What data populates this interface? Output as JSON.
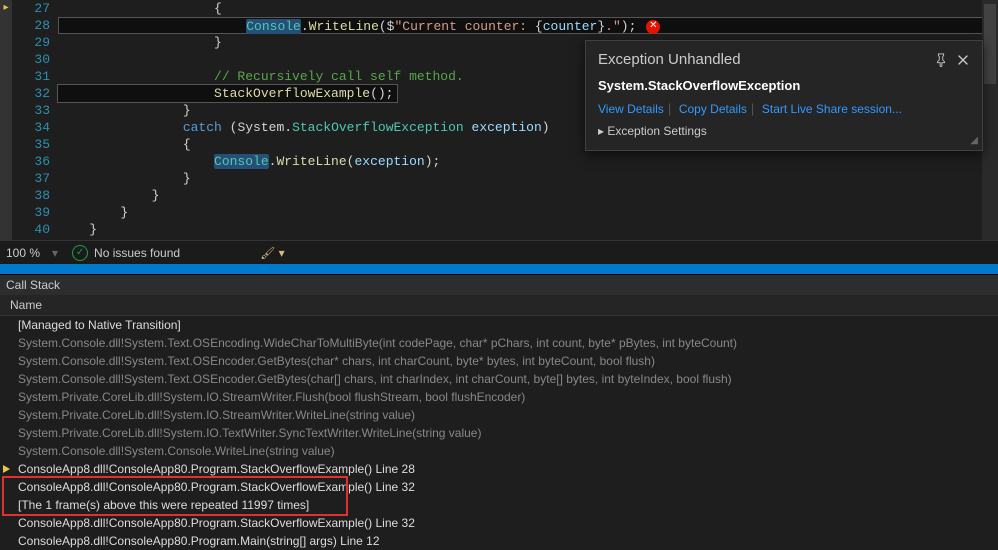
{
  "editor": {
    "line_start": 27,
    "lines": [
      {
        "n": 27,
        "indent": 10,
        "raw": "{"
      },
      {
        "n": 28,
        "indent": 12,
        "hl": true,
        "raw_html": "<span class='tok-sel'><span class='tok-type'>Console</span></span><span class='tok-txt'>.</span><span class='tok-mth'>WriteLine</span><span class='tok-txt'>($</span><span class='tok-str'>\"Current counter: </span><span class='tok-txt'>{</span><span class='tok-var'>counter</span><span class='tok-txt'>}</span><span class='tok-str'>.\"</span><span class='tok-txt'>);</span>",
        "err": true
      },
      {
        "n": 29,
        "indent": 10,
        "raw": "}"
      },
      {
        "n": 30,
        "indent": 0,
        "raw": ""
      },
      {
        "n": 31,
        "indent": 10,
        "raw_html": "<span class='tok-cmt'>// Recursively call self method.</span>"
      },
      {
        "n": 32,
        "indent": 10,
        "raw_html": "<span class='tok-mth'>StackOverflowExample</span><span class='tok-txt'>();</span>",
        "boxed": true
      },
      {
        "n": 33,
        "indent": 8,
        "raw": "}"
      },
      {
        "n": 34,
        "indent": 8,
        "raw_html": "<span class='tok-kw'>catch</span> <span class='tok-txt'>(System.</span><span class='tok-type'>StackOverflowException</span> <span class='tok-var'>exception</span><span class='tok-txt'>)</span>"
      },
      {
        "n": 35,
        "indent": 8,
        "raw": "{"
      },
      {
        "n": 36,
        "indent": 10,
        "raw_html": "<span class='tok-sel'><span class='tok-type'>Console</span></span><span class='tok-txt'>.</span><span class='tok-mth'>WriteLine</span><span class='tok-txt'>(</span><span class='tok-var'>exception</span><span class='tok-txt'>);</span>"
      },
      {
        "n": 37,
        "indent": 8,
        "raw": "}"
      },
      {
        "n": 38,
        "indent": 6,
        "raw": "}"
      },
      {
        "n": 39,
        "indent": 4,
        "raw": "}"
      },
      {
        "n": 40,
        "indent": 2,
        "raw": "}"
      }
    ]
  },
  "exception": {
    "title": "Exception Unhandled",
    "type": "System.StackOverflowException",
    "links": {
      "view": "View Details",
      "copy": "Copy Details",
      "live": "Start Live Share session..."
    },
    "settings": "Exception Settings"
  },
  "status": {
    "zoom": "100 %",
    "issues": "No issues found"
  },
  "callstack": {
    "title": "Call Stack",
    "header": "Name",
    "rows": [
      {
        "t": "[Managed to Native Transition]",
        "bright": true
      },
      {
        "t": "System.Console.dll!System.Text.OSEncoding.WideCharToMultiByte(int codePage, char* pChars, int count, byte* pBytes, int byteCount)"
      },
      {
        "t": "System.Console.dll!System.Text.OSEncoder.GetBytes(char* chars, int charCount, byte* bytes, int byteCount, bool flush)"
      },
      {
        "t": "System.Console.dll!System.Text.OSEncoder.GetBytes(char[] chars, int charIndex, int charCount, byte[] bytes, int byteIndex, bool flush)"
      },
      {
        "t": "System.Private.CoreLib.dll!System.IO.StreamWriter.Flush(bool flushStream, bool flushEncoder)"
      },
      {
        "t": "System.Private.CoreLib.dll!System.IO.StreamWriter.WriteLine(string value)"
      },
      {
        "t": "System.Private.CoreLib.dll!System.IO.TextWriter.SyncTextWriter.WriteLine(string value)"
      },
      {
        "t": "System.Console.dll!System.Console.WriteLine(string value)"
      },
      {
        "t": "ConsoleApp8.dll!ConsoleApp80.Program.StackOverflowExample() Line 28",
        "bright": true,
        "arrow": true
      },
      {
        "t": "ConsoleApp8.dll!ConsoleApp80.Program.StackOverflowExample() Line 32",
        "bright": true
      },
      {
        "t": "[The 1 frame(s) above this were repeated 11997 times]",
        "bright": true,
        "redbox": true
      },
      {
        "t": "ConsoleApp8.dll!ConsoleApp80.Program.StackOverflowExample() Line 32",
        "bright": true
      },
      {
        "t": "ConsoleApp8.dll!ConsoleApp80.Program.Main(string[] args) Line 12",
        "bright": true
      }
    ]
  }
}
